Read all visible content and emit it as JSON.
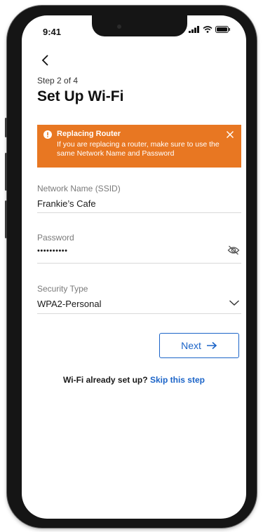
{
  "status_bar": {
    "time": "9:41"
  },
  "header": {
    "step": "Step 2 of 4",
    "title": "Set Up Wi-Fi"
  },
  "alert": {
    "title": "Replacing Router",
    "body": "If you are replacing a router, make sure to use the same Network Name and Password",
    "color": "#e87722"
  },
  "form": {
    "network_name": {
      "label": "Network Name (SSID)",
      "value": "Frankie’s Cafe"
    },
    "password": {
      "label": "Password",
      "value": "••••••••••"
    },
    "security_type": {
      "label": "Security Type",
      "value": "WPA2-Personal"
    }
  },
  "actions": {
    "next_label": "Next",
    "skip_prompt": "Wi-Fi already set up?",
    "skip_link": "Skip this step",
    "accent_color": "#1b64c8"
  },
  "icons": [
    "back-arrow-icon",
    "signal-icon",
    "wifi-icon",
    "battery-icon",
    "info-icon",
    "close-icon",
    "eye-off-icon",
    "chevron-down-icon",
    "arrow-right-icon"
  ]
}
